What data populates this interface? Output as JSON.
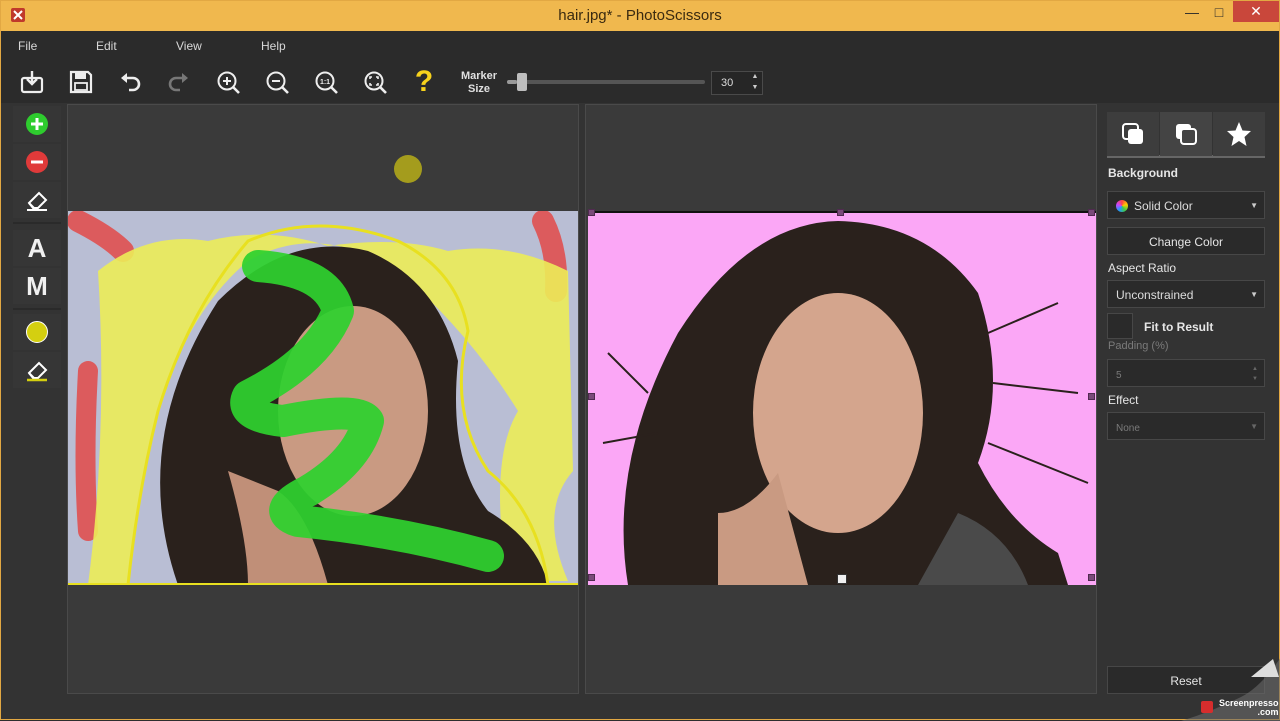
{
  "window": {
    "title": "hair.jpg* - PhotoScissors",
    "controls": {
      "minimize": "—",
      "maximize": "□",
      "close": "✕"
    }
  },
  "menu": [
    "File",
    "Edit",
    "View",
    "Help"
  ],
  "toolbar": {
    "buttons": [
      "open-icon",
      "save-icon",
      "undo-icon",
      "redo-icon",
      "zoom-in-icon",
      "zoom-out-icon",
      "zoom-actual-icon",
      "zoom-fit-icon",
      "help-icon"
    ],
    "actual_size_label": "1:1",
    "help_label": "?",
    "marker_label_line1": "Marker",
    "marker_label_line2": "Size",
    "marker_size": "30",
    "marker_slider_fraction": 0.05
  },
  "left_tools": {
    "keep_icon": "plus-circle-icon",
    "remove_icon": "minus-circle-icon",
    "eraser_icon": "eraser-icon",
    "auto_label": "A",
    "manual_label": "M",
    "marker_color": "#d4cf10",
    "marker_eraser_icon": "eraser-icon"
  },
  "colors": {
    "keep": "#2ecc2e",
    "remove": "#e03a3a",
    "background_result": "#fba7f6",
    "marker": "#d4cf10"
  },
  "panel": {
    "tabs": [
      "background-tab-icon",
      "foreground-tab-icon",
      "effects-tab-icon"
    ],
    "background_label": "Background",
    "background_value": "Solid Color",
    "change_color_label": "Change Color",
    "aspect_ratio_label": "Aspect Ratio",
    "aspect_ratio_value": "Unconstrained",
    "fit_to_result_label": "Fit to Result",
    "padding_label": "Padding (%)",
    "padding_value": "5",
    "effect_label": "Effect",
    "effect_value": "None",
    "reset_label": "Reset"
  },
  "watermark": {
    "line1": "Screenpresso",
    "line2": ".com"
  }
}
